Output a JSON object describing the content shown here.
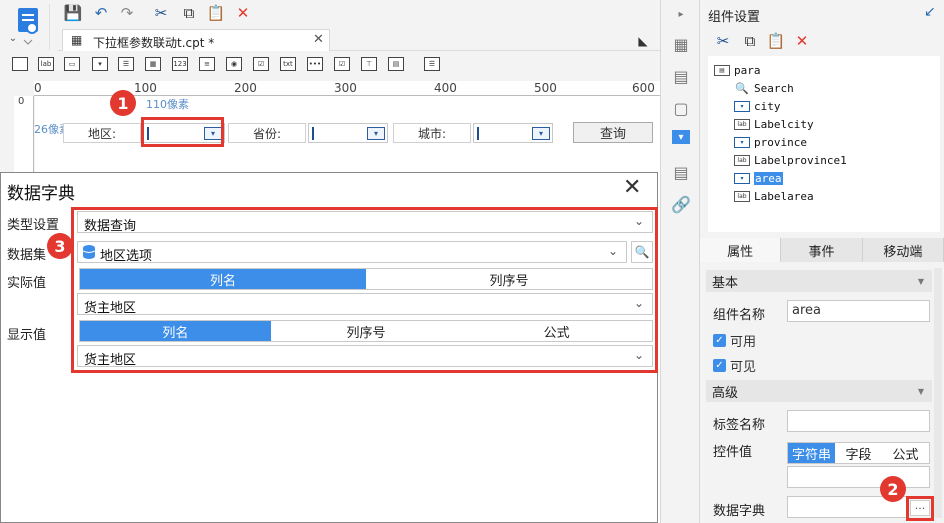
{
  "file_tab": {
    "label": "下拉框参数联动t.cpt *"
  },
  "ruler": {
    "ticks": [
      "0",
      "100",
      "200",
      "300",
      "400",
      "500",
      "600"
    ],
    "v_tick": "0"
  },
  "canvas": {
    "pixel_x": "110像素",
    "pixel_y": "26像素",
    "label_area": "地区:",
    "label_province": "省份:",
    "label_city": "城市:",
    "query_button": "查询"
  },
  "badges": {
    "b1": "1",
    "b2": "2",
    "b3": "3"
  },
  "dialog": {
    "title": "数据字典",
    "close": "✕",
    "type_label": "类型设置",
    "type_value": "数据查询",
    "dataset_label": "数据集",
    "dataset_value": "地区选项",
    "actual_label": "实际值",
    "actual_tabs": [
      "列名",
      "列序号"
    ],
    "actual_value": "货主地区",
    "display_label": "显示值",
    "display_tabs": [
      "列名",
      "列序号",
      "公式"
    ],
    "display_value": "货主地区"
  },
  "right_panel": {
    "title": "组件设置",
    "tree": [
      {
        "name": "para",
        "type": "root"
      },
      {
        "name": "Search",
        "type": "search"
      },
      {
        "name": "city",
        "type": "combo"
      },
      {
        "name": "Labelcity",
        "type": "label"
      },
      {
        "name": "province",
        "type": "combo"
      },
      {
        "name": "Labelprovince1",
        "type": "label"
      },
      {
        "name": "area",
        "type": "combo",
        "selected": true
      },
      {
        "name": "Labelarea",
        "type": "label"
      }
    ],
    "tabs": [
      "属性",
      "事件",
      "移动端"
    ],
    "section_basic": "基本",
    "widget_name_label": "组件名称",
    "widget_name_value": "area",
    "enabled_label": "可用",
    "visible_label": "可见",
    "section_advanced": "高级",
    "tag_name_label": "标签名称",
    "widget_value_label": "控件值",
    "widget_value_tabs": [
      "字符串",
      "字段",
      "公式"
    ],
    "data_dict_label": "数据字典",
    "data_dict_button": "···"
  },
  "colors": {
    "accent": "#3d8ee8",
    "highlight_red": "#e2382f"
  }
}
